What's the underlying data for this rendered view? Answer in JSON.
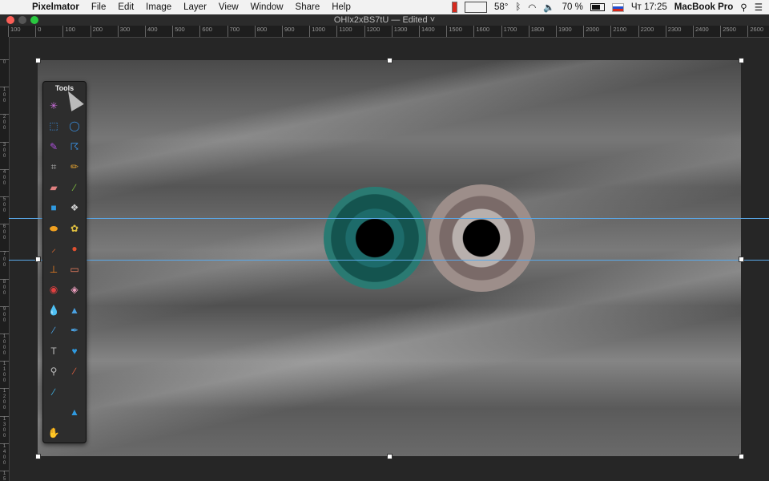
{
  "menubar": {
    "apple_icon": "apple-icon",
    "app_name": "Pixelmator",
    "items": [
      "File",
      "Edit",
      "Image",
      "Layer",
      "View",
      "Window",
      "Share",
      "Help"
    ]
  },
  "status": {
    "temperature": "58°",
    "battery": "70 %",
    "clock": "Чт 17:25",
    "machine": "MacBook Pro"
  },
  "window": {
    "title": "OHIx2xBS7tU — Edited ˅"
  },
  "ruler": {
    "top_labels": [
      "100",
      "0",
      "100",
      "200",
      "300",
      "400",
      "500",
      "600",
      "700",
      "800",
      "900",
      "1000",
      "1100",
      "1200",
      "1300",
      "1400",
      "1500",
      "1600",
      "1700",
      "1800",
      "1900",
      "2000",
      "2100",
      "2200",
      "2300",
      "2400",
      "2500",
      "2600"
    ],
    "left_labels": [
      "0",
      "100",
      "200",
      "300",
      "400",
      "500",
      "600",
      "700",
      "800",
      "900",
      "1000",
      "1100",
      "1200",
      "1300",
      "1400",
      "1500"
    ]
  },
  "tools_panel": {
    "title": "Tools",
    "tools": [
      {
        "name": "magic-wand-icon",
        "glyph": "✳",
        "color": "#d070e0"
      },
      {
        "name": "tool-spacer",
        "glyph": "",
        "color": "#000"
      },
      {
        "name": "rect-select-icon",
        "glyph": "⬚",
        "color": "#3a8fe0"
      },
      {
        "name": "ellipse-select-icon",
        "glyph": "◯",
        "color": "#3a8fe0"
      },
      {
        "name": "magnetic-lasso-icon",
        "glyph": "✎",
        "color": "#b050e0"
      },
      {
        "name": "lasso-icon",
        "glyph": "☈",
        "color": "#3a8fe0"
      },
      {
        "name": "crop-icon",
        "glyph": "⌗",
        "color": "#aaaaaa"
      },
      {
        "name": "eyedropper-icon",
        "glyph": "✏",
        "color": "#e0a030"
      },
      {
        "name": "eraser-icon",
        "glyph": "▰",
        "color": "#e08080"
      },
      {
        "name": "pencil-icon",
        "glyph": "∕",
        "color": "#80c040"
      },
      {
        "name": "shape-icon",
        "glyph": "■",
        "color": "#2f9ae0"
      },
      {
        "name": "stamp-icon",
        "glyph": "❖",
        "color": "#cccccc"
      },
      {
        "name": "sponge-icon",
        "glyph": "⬬",
        "color": "#f0a020"
      },
      {
        "name": "paint-bucket-icon",
        "glyph": "✿",
        "color": "#e0c040"
      },
      {
        "name": "brush-icon",
        "glyph": "⸝",
        "color": "#f07030"
      },
      {
        "name": "burn-icon",
        "glyph": "●",
        "color": "#e05030"
      },
      {
        "name": "clone-icon",
        "glyph": "⊥",
        "color": "#f08020"
      },
      {
        "name": "healing-icon",
        "glyph": "▭",
        "color": "#f08060"
      },
      {
        "name": "red-eye-icon",
        "glyph": "◉",
        "color": "#e04040"
      },
      {
        "name": "eraser-alt-icon",
        "glyph": "◈",
        "color": "#f0a0c0"
      },
      {
        "name": "blur-icon",
        "glyph": "💧",
        "color": "#4aa0e0"
      },
      {
        "name": "sharpen-icon",
        "glyph": "▲",
        "color": "#4aa0e0"
      },
      {
        "name": "pen-icon",
        "glyph": "∕",
        "color": "#4aa0e0"
      },
      {
        "name": "freeform-pen-icon",
        "glyph": "✒",
        "color": "#4aa0e0"
      },
      {
        "name": "type-icon",
        "glyph": "T",
        "color": "#bbbbbb"
      },
      {
        "name": "heart-shape-icon",
        "glyph": "♥",
        "color": "#2f9ae0"
      },
      {
        "name": "zoom-icon",
        "glyph": "⚲",
        "color": "#bbbbbb"
      },
      {
        "name": "color-brush-icon",
        "glyph": "∕",
        "color": "#e06040"
      },
      {
        "name": "smudge-icon",
        "glyph": "∕",
        "color": "#40b0e0"
      },
      {
        "name": "tool-spacer-2",
        "glyph": "",
        "color": "#000"
      },
      {
        "name": "tool-spacer-3",
        "glyph": "",
        "color": "#000"
      },
      {
        "name": "triangle-shape-icon",
        "glyph": "▲",
        "color": "#2f9ae0"
      },
      {
        "name": "hand-icon",
        "glyph": "✋",
        "color": "#dddddd"
      }
    ]
  }
}
